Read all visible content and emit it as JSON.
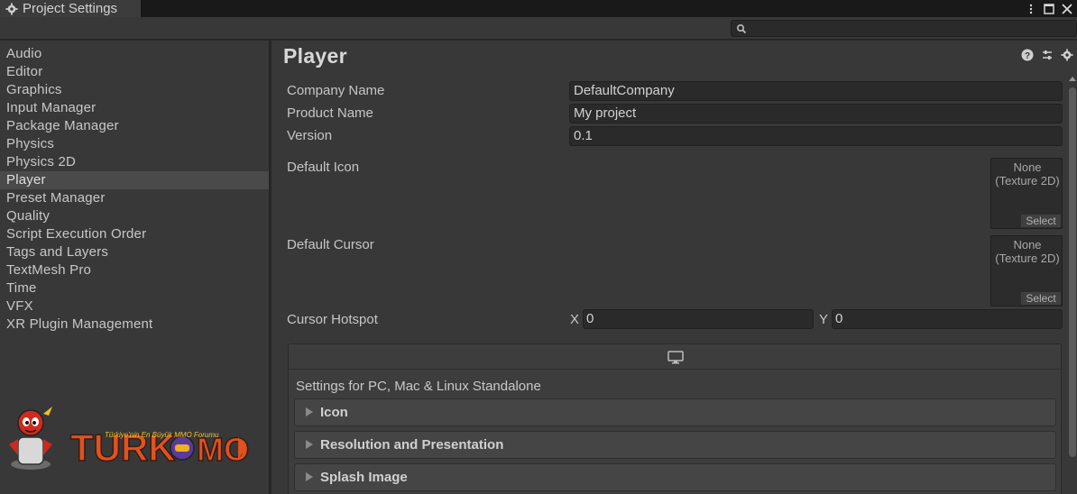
{
  "window": {
    "tab_title": "Project Settings",
    "controls": [
      "kebab-menu",
      "maximize",
      "close"
    ]
  },
  "search": {
    "placeholder": ""
  },
  "sidebar": {
    "items": [
      {
        "label": "Audio"
      },
      {
        "label": "Editor"
      },
      {
        "label": "Graphics"
      },
      {
        "label": "Input Manager"
      },
      {
        "label": "Package Manager"
      },
      {
        "label": "Physics"
      },
      {
        "label": "Physics 2D"
      },
      {
        "label": "Player",
        "selected": true
      },
      {
        "label": "Preset Manager"
      },
      {
        "label": "Quality"
      },
      {
        "label": "Script Execution Order"
      },
      {
        "label": "Tags and Layers"
      },
      {
        "label": "TextMesh Pro"
      },
      {
        "label": "Time"
      },
      {
        "label": "VFX"
      },
      {
        "label": "XR Plugin Management"
      }
    ],
    "logo": {
      "name": "TurkMMO",
      "tagline": "Türkiye'nin En Büyük MMO Forumu"
    }
  },
  "main": {
    "title": "Player",
    "header_icons": [
      "help-icon",
      "preset-icon",
      "settings-gear-icon"
    ],
    "company_name": {
      "label": "Company Name",
      "value": "DefaultCompany"
    },
    "product_name": {
      "label": "Product Name",
      "value": "My project"
    },
    "version": {
      "label": "Version",
      "value": "0.1"
    },
    "default_icon": {
      "label": "Default Icon",
      "slot_text_1": "None",
      "slot_text_2": "(Texture 2D)",
      "select_label": "Select"
    },
    "default_cursor": {
      "label": "Default Cursor",
      "slot_text_1": "None",
      "slot_text_2": "(Texture 2D)",
      "select_label": "Select"
    },
    "cursor_hotspot": {
      "label": "Cursor Hotspot",
      "x_label": "X",
      "x_value": "0",
      "y_label": "Y",
      "y_value": "0"
    },
    "platform": {
      "icon": "monitor-icon",
      "settings_label": "Settings for PC, Mac & Linux Standalone",
      "foldouts": [
        {
          "label": "Icon"
        },
        {
          "label": "Resolution and Presentation"
        },
        {
          "label": "Splash Image"
        }
      ]
    }
  }
}
